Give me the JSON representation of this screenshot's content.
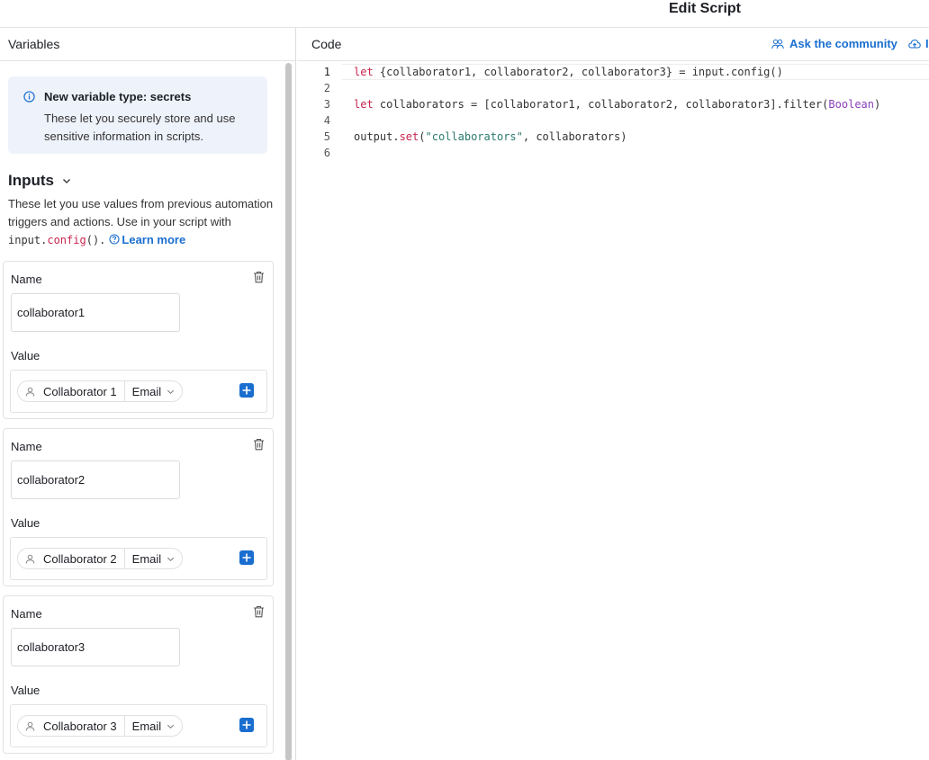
{
  "window": {
    "title": "Edit Script"
  },
  "variables_panel": {
    "header": "Variables",
    "notice": {
      "title": "New variable type: secrets",
      "body": "These let you securely store and use sensitive information in scripts."
    },
    "inputs": {
      "heading": "Inputs",
      "desc_text": "These let you use values from previous automation triggers and actions. Use in your script with ",
      "code_input": "input.",
      "code_config": "config",
      "code_parens": "().",
      "learn_more": "Learn more"
    },
    "cards": [
      {
        "name_label": "Name",
        "name_value": "collaborator1",
        "value_label": "Value",
        "token": "Collaborator 1",
        "field": "Email"
      },
      {
        "name_label": "Name",
        "name_value": "collaborator2",
        "value_label": "Value",
        "token": "Collaborator 2",
        "field": "Email"
      },
      {
        "name_label": "Name",
        "name_value": "collaborator3",
        "value_label": "Value",
        "token": "Collaborator 3",
        "field": "Email"
      }
    ]
  },
  "code_panel": {
    "header": "Code",
    "ask_community": "Ask the community",
    "cut_off_link": "I",
    "lines": {
      "l1": {
        "num": "1",
        "kw": "let",
        "rest": " {collaborator1, collaborator2, collaborator3} = input.config()"
      },
      "l2": {
        "num": "2"
      },
      "l3": {
        "num": "3",
        "kw": "let",
        "rest": " collaborators = [collaborator1, collaborator2, collaborator3].filter(",
        "bool": "Boolean",
        "tail": ")"
      },
      "l4": {
        "num": "4"
      },
      "l5": {
        "num": "5",
        "pre": "output.",
        "method": "set",
        "paren": "(",
        "str": "\"collaborators\"",
        "tail": ", collaborators)"
      },
      "l6": {
        "num": "6"
      }
    }
  },
  "colors": {
    "accent": "#1a6ecf",
    "notice_bg": "#eef2fb",
    "keyword": "#c7254e",
    "string": "#2a7a6e",
    "boolean": "#8a3fb8"
  }
}
